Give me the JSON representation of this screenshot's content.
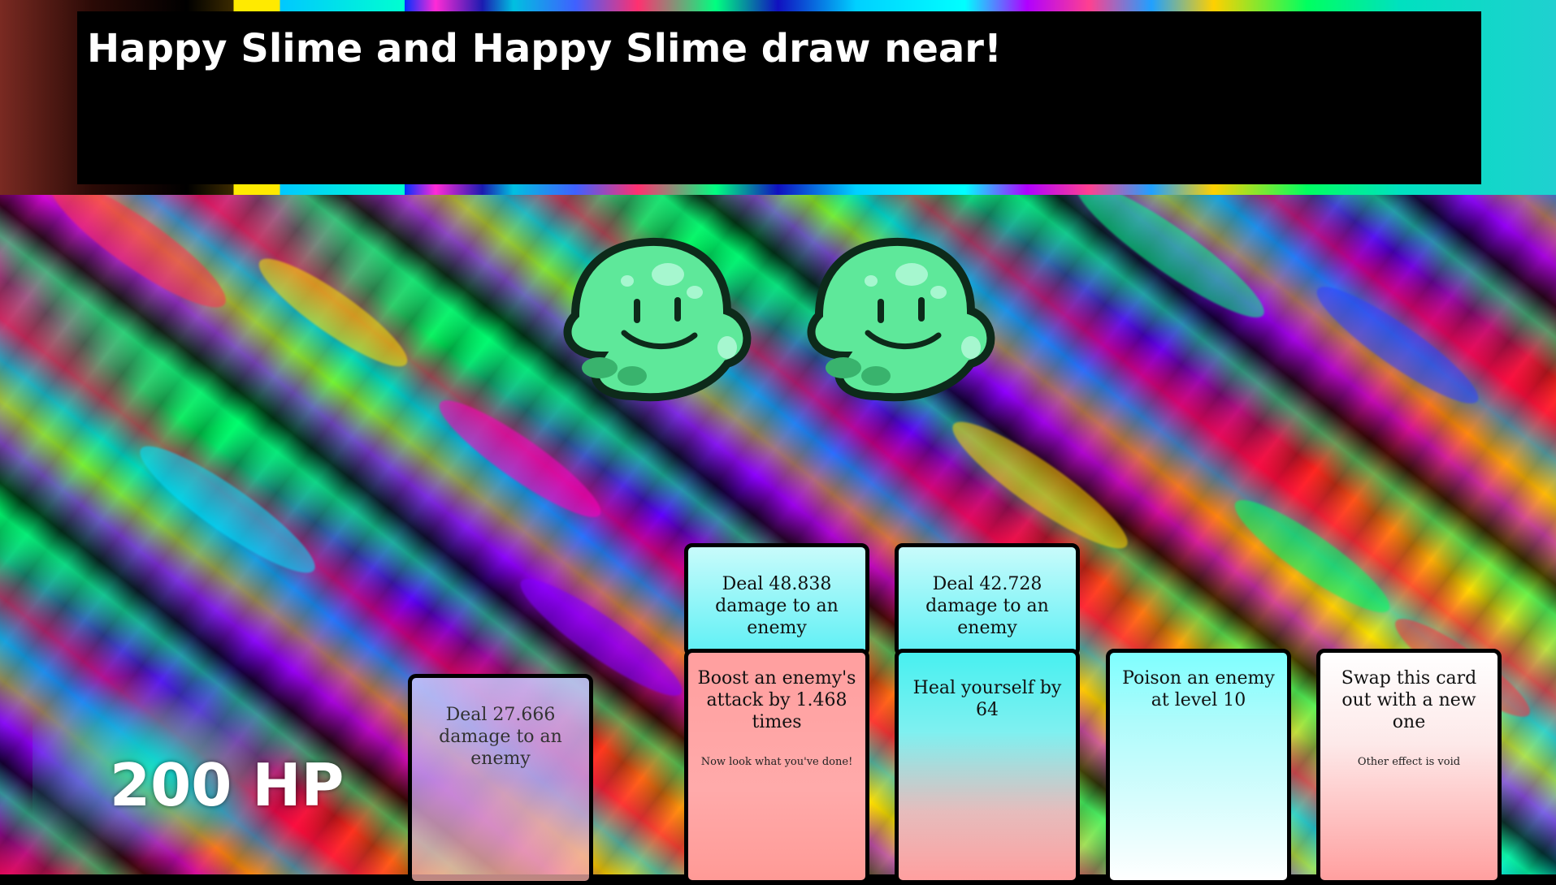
{
  "message": "Happy Slime and Happy Slime draw near!",
  "enemies": [
    {
      "name": "Happy Slime",
      "icon": "happy-slime-icon"
    },
    {
      "name": "Happy Slime",
      "icon": "happy-slime-icon"
    }
  ],
  "player": {
    "hp_label": "200 HP"
  },
  "cards": [
    {
      "title": "Deal 27.666 damage to an enemy",
      "sub": ""
    },
    {
      "title": "Deal 48.838 damage to an enemy",
      "sub": ""
    },
    {
      "title": "Boost an enemy's attack by 1.468 times",
      "sub": "Now look what you've done!"
    },
    {
      "title": "Deal 42.728 damage to an enemy",
      "sub": ""
    },
    {
      "title": "Heal yourself by 64",
      "sub": ""
    },
    {
      "title": "Poison an enemy at level 10",
      "sub": ""
    },
    {
      "title": "Swap this card out with a new one",
      "sub": "Other effect is void"
    }
  ],
  "colors": {
    "slime_body": "#5ee89a",
    "slime_outline": "#0d2a1a",
    "card_cyan": "#5ff0f5",
    "card_pink": "#ff9f9f"
  }
}
